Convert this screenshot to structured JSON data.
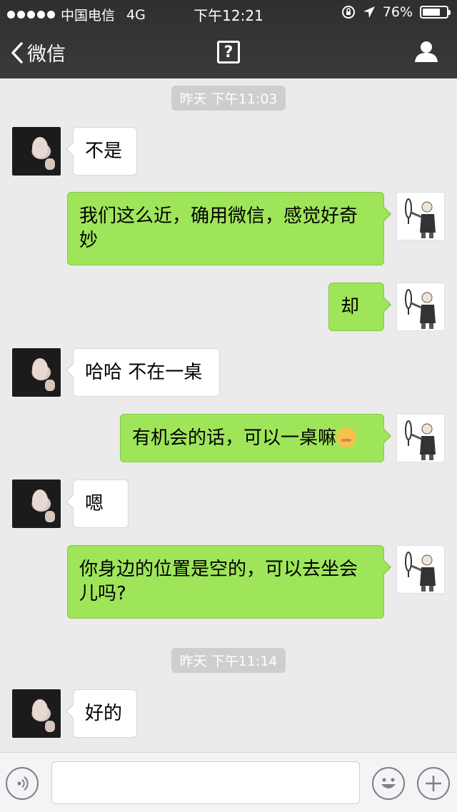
{
  "status_bar": {
    "carrier": "中国电信",
    "network": "4G",
    "time": "下午12:21",
    "battery": "76%",
    "battery_level": 0.76
  },
  "nav": {
    "back_label": "微信",
    "help_symbol": "?"
  },
  "messages": [
    {
      "type": "timestamp",
      "text": "昨天 下午11:03"
    },
    {
      "type": "message",
      "side": "in",
      "text": "不是"
    },
    {
      "type": "message",
      "side": "out",
      "lines": [
        "我们这么近，确用微信，感觉好奇",
        "妙"
      ]
    },
    {
      "type": "message",
      "side": "out",
      "text": "却"
    },
    {
      "type": "message",
      "side": "in",
      "text": "哈哈 不在一桌"
    },
    {
      "type": "message",
      "side": "out",
      "text": "有机会的话，可以一桌嘛",
      "emoji": "blushing-face-icon"
    },
    {
      "type": "message",
      "side": "in",
      "text": "嗯"
    },
    {
      "type": "message",
      "side": "out",
      "lines": [
        "你身边的位置是空的，可以去坐会",
        "儿吗?"
      ]
    },
    {
      "type": "timestamp",
      "text": "昨天 下午11:14"
    },
    {
      "type": "message",
      "side": "in",
      "text": "好的"
    }
  ],
  "input_bar": {
    "voice_icon": "voice-icon",
    "emoji_icon": "emoji-icon",
    "plus_icon": "plus-icon"
  },
  "colors": {
    "bubble_out": "#9fe55a",
    "bubble_in": "#ffffff",
    "background": "#ebebeb",
    "topbar": "#2e2f31"
  }
}
